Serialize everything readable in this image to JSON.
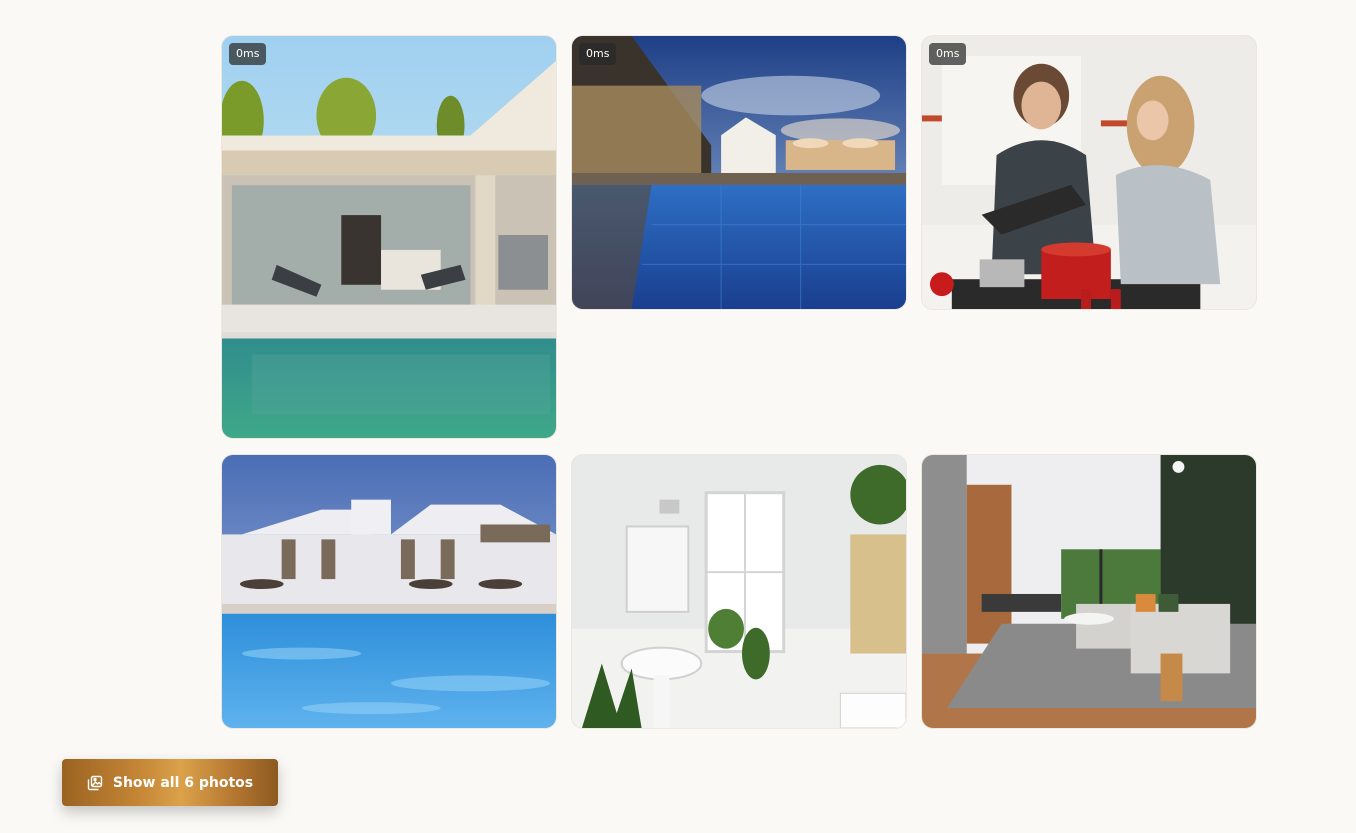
{
  "gallery": {
    "photos": [
      {
        "alt": "Modern villa with glass walls and pool",
        "badge": "0ms"
      },
      {
        "alt": "Resort pool at dusk",
        "badge": "0ms"
      },
      {
        "alt": "Couple cooking in kitchen",
        "badge": "0ms"
      },
      {
        "alt": "White resort building with blue pool",
        "badge": ""
      },
      {
        "alt": "White bathroom with plants",
        "badge": ""
      },
      {
        "alt": "Living room with grey sofa",
        "badge": ""
      }
    ]
  },
  "show_all_button": {
    "label": "Show all 6 photos",
    "icon": "photo-gallery-icon"
  },
  "colors": {
    "page_background": "#faf9f6",
    "button_gold": "#c48535",
    "badge_background": "#282828"
  }
}
